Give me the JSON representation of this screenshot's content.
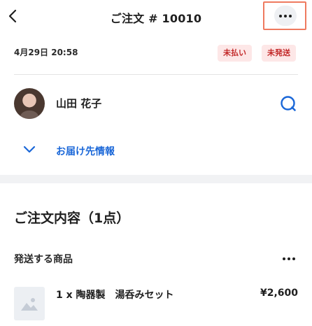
{
  "header": {
    "title": "ご注文 # 10010",
    "back_icon": "chevron-left-icon",
    "more_icon": "more-horizontal-icon"
  },
  "order": {
    "date": "4月29日 20:58",
    "badges": [
      "未払い",
      "未発送"
    ]
  },
  "customer": {
    "name": "山田 花子",
    "chat_icon": "chat-icon"
  },
  "delivery": {
    "label": "お届け先情報",
    "icon": "chevron-down-icon"
  },
  "contents": {
    "title": "ご注文内容（1点）",
    "section_label": "発送する商品",
    "items": [
      {
        "name": "1 x 陶器製　湯呑みセット",
        "price": "¥2,600"
      }
    ]
  },
  "colors": {
    "accent": "#1a67d8",
    "badge_text": "#c32a2a",
    "badge_bg": "#fde7e7",
    "highlight": "#ef7a5f"
  }
}
